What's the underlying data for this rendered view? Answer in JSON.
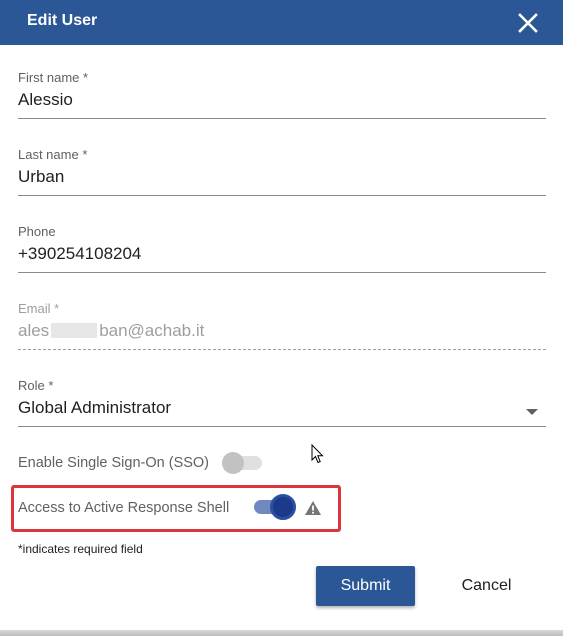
{
  "dialog": {
    "title": "Edit User",
    "close_icon": "close-icon"
  },
  "fields": {
    "first_name": {
      "label": "First name *",
      "value": "Alessio"
    },
    "last_name": {
      "label": "Last name *",
      "value": "Urban"
    },
    "phone": {
      "label": "Phone",
      "value": "+390254108204"
    },
    "email": {
      "label": "Email *",
      "value_start": "ales",
      "value_end": "ban@achab.it",
      "disabled": true
    },
    "role": {
      "label": "Role *",
      "value": "Global Administrator",
      "dropdown_icon": "chevron-down-icon"
    }
  },
  "toggles": {
    "sso": {
      "label": "Enable Single Sign-On (SSO)",
      "checked": false
    },
    "shell": {
      "label": "Access to Active Response Shell",
      "checked": true,
      "warning_icon": "warning-icon"
    }
  },
  "footer": {
    "required_note": "*indicates required field",
    "submit_label": "Submit",
    "cancel_label": "Cancel"
  },
  "colors": {
    "header_bg": "#2b5797",
    "primary_button": "#2b5797",
    "highlight_border": "#d9363e",
    "toggle_on_thumb": "#1a3a8a",
    "toggle_on_track": "#6f88bd"
  }
}
